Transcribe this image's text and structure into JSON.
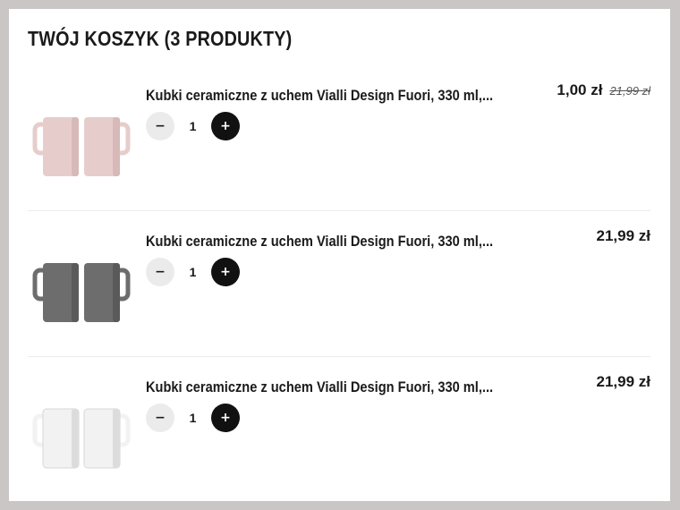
{
  "cart": {
    "title": "TWÓJ KOSZYK (3 PRODUKTY)",
    "items": [
      {
        "name": "Kubki ceramiczne z uchem Vialli Design Fuori, 330 ml,...",
        "quantity": "1",
        "price": "1,00 zł",
        "old_price": "21,99 zł",
        "mug_color": "#e6cdcc",
        "mug_shade": "#d7b9b8"
      },
      {
        "name": "Kubki ceramiczne z uchem Vialli Design Fuori, 330 ml,...",
        "quantity": "1",
        "price": "21,99 zł",
        "old_price": "",
        "mug_color": "#6d6d6d",
        "mug_shade": "#5a5a5a"
      },
      {
        "name": "Kubki ceramiczne z uchem Vialli Design Fuori, 330 ml,...",
        "quantity": "1",
        "price": "21,99 zł",
        "old_price": "",
        "mug_color": "#f2f2f2",
        "mug_shade": "#dcdcdc"
      }
    ]
  },
  "controls": {
    "minus_label": "−",
    "plus_label": "+"
  },
  "icons": {
    "product_image": "mug-pair-image"
  }
}
